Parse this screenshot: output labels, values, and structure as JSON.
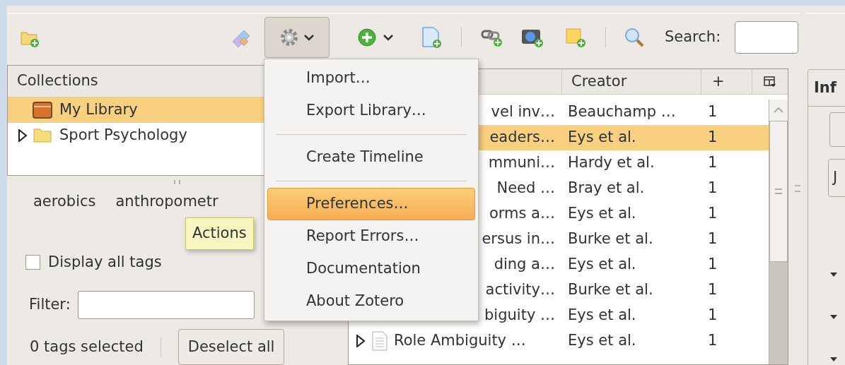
{
  "collections": {
    "header": "Collections",
    "items": [
      {
        "label": "My Library",
        "kind": "library",
        "selected": true
      },
      {
        "label": "Sport Psychology",
        "kind": "folder",
        "selected": false,
        "expanded": false
      }
    ]
  },
  "tags": {
    "rows": [
      [
        "aerobics",
        "anthropometr"
      ]
    ],
    "display_all": {
      "label": "Display all tags",
      "checked": false
    },
    "filter_label": "Filter:",
    "selected_count": "0 tags selected",
    "deselect_button": "Deselect all"
  },
  "items_toolbar": {
    "search_label": "Search:"
  },
  "items_table": {
    "columns": [
      {
        "label": "Creator"
      },
      {
        "label": "+"
      }
    ],
    "rows": [
      {
        "kind": "covered",
        "title": "vel inv…",
        "creator": "Beauchamp …",
        "count": "1",
        "selected": false
      },
      {
        "kind": "covered",
        "title": "eaders…",
        "creator": "Eys et al.",
        "count": "1",
        "selected": true
      },
      {
        "kind": "covered",
        "title": "mmuni…",
        "creator": "Hardy et al.",
        "count": "1",
        "selected": false
      },
      {
        "kind": "covered",
        "title": "Need …",
        "creator": "Bray et al.",
        "count": "1",
        "selected": false
      },
      {
        "kind": "covered",
        "title": "orms a…",
        "creator": "Eys et al.",
        "count": "1",
        "selected": false
      },
      {
        "kind": "covered",
        "title": "ersus in…",
        "creator": "Burke et al.",
        "count": "1",
        "selected": false
      },
      {
        "kind": "covered",
        "title": "ding a…",
        "creator": "Eys et al.",
        "count": "1",
        "selected": false
      },
      {
        "kind": "covered",
        "title": "activity…",
        "creator": "Burke et al.",
        "count": "1",
        "selected": false
      },
      {
        "kind": "covered",
        "title": "biguity …",
        "creator": "Eys et al.",
        "count": "1",
        "selected": false
      },
      {
        "kind": "item",
        "title": "Role Ambiguity …",
        "creator": "Eys et al.",
        "count": "1",
        "selected": false,
        "expanded": false
      }
    ]
  },
  "item_pane": {
    "tab": "Inf",
    "button_label": "J"
  },
  "actions_menu": {
    "items": [
      {
        "kind": "item",
        "label": "Import…",
        "selected": false
      },
      {
        "kind": "item",
        "label": "Export Library…",
        "selected": false
      },
      {
        "kind": "separator"
      },
      {
        "kind": "item",
        "label": "Create Timeline",
        "selected": false
      },
      {
        "kind": "separator"
      },
      {
        "kind": "item",
        "label": "Preferences…",
        "selected": true
      },
      {
        "kind": "item",
        "label": "Report Errors…",
        "selected": false
      },
      {
        "kind": "item",
        "label": "Documentation",
        "selected": false
      },
      {
        "kind": "item",
        "label": "About Zotero",
        "selected": false
      }
    ]
  },
  "tooltip": "Actions"
}
